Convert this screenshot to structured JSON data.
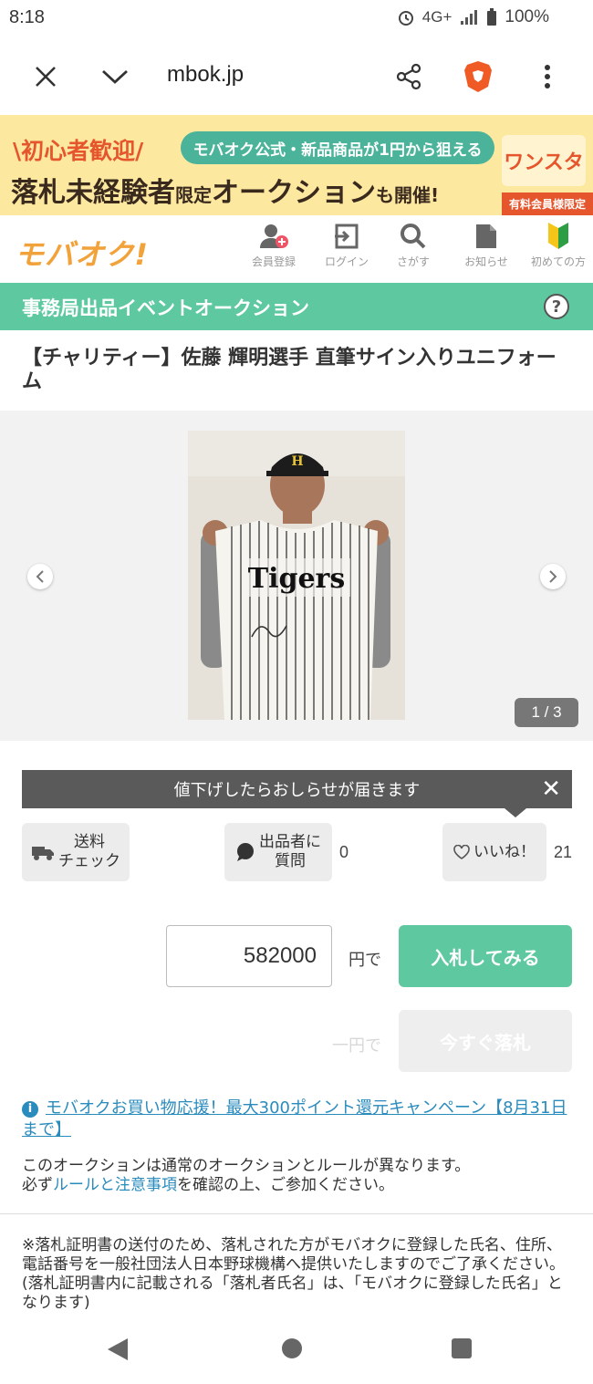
{
  "status_bar": {
    "time": "8:18",
    "network": "4G+",
    "battery": "100%"
  },
  "browser": {
    "url": "mbok.jp",
    "icons": [
      "close-icon",
      "chevron-down-icon",
      "share-icon",
      "brave-lion-icon",
      "more-vert-icon"
    ]
  },
  "banner": {
    "left_text": "\\初心者歓迎/",
    "pill_text": "モバオク公式・新品商品が1円から狙える",
    "main_text_a": "落札未経験者",
    "main_text_b": "限定",
    "main_text_c": "オークション",
    "main_text_d": "も開催!",
    "logo_text": "ワンスタ",
    "tag_text": "有料会員様限定"
  },
  "site_header": {
    "logo": "モバオク!",
    "nav": [
      {
        "label": "会員登録",
        "icon": "user-add-icon"
      },
      {
        "label": "ログイン",
        "icon": "login-icon"
      },
      {
        "label": "さがす",
        "icon": "search-icon"
      },
      {
        "label": "お知らせ",
        "icon": "document-icon"
      },
      {
        "label": "初めての方",
        "icon": "beginner-mark-icon"
      }
    ]
  },
  "section": {
    "title": "事務局出品イベントオークション",
    "help": "?"
  },
  "item": {
    "title": "【チャリティー】佐藤 輝明選手 直筆サイン入りユニフォーム",
    "jersey_text": "Tigers",
    "counter": "1 / 3"
  },
  "notify": {
    "text": "値下げしたらおしらせが届きます"
  },
  "actions": {
    "shipping_label": "送料\nチェック",
    "question_label": "出品者に\n質問",
    "question_count": "0",
    "like_label": "いいね！",
    "like_count": "21"
  },
  "bid": {
    "value": "582000",
    "yen_label": "円で",
    "bid_button": "入札してみる",
    "buynow_yen": "一円で",
    "buynow_button": "今すぐ落札"
  },
  "campaign": {
    "text": "モバオクお買い物応援！最大300ポイント還元キャンペーン【8月31日まで】"
  },
  "rules": {
    "line1": "このオークションは通常のオークションとルールが異なります。",
    "prefix": "必ず",
    "link": "ルールと注意事項",
    "suffix": "を確認の上、ご参加ください。"
  },
  "notice": {
    "text": "※落札証明書の送付のため、落札された方がモバオクに登録した氏名、住所、電話番号を一般社団法人日本野球機構へ提供いたしますのでご了承ください。\n(落札証明書内に記載される「落札者氏名」は、「モバオクに登録した氏名」となります)"
  }
}
